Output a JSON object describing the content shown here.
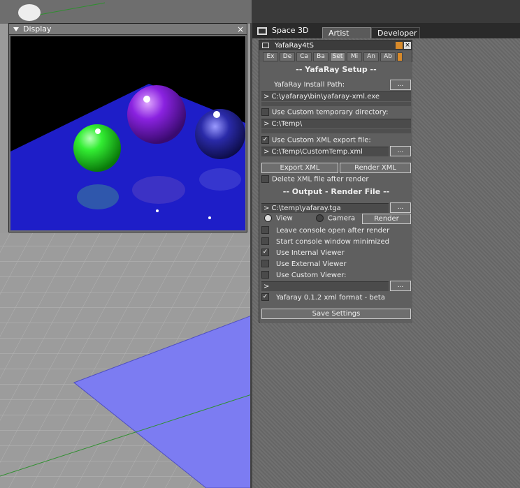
{
  "display": {
    "title": "Display",
    "close": "×"
  },
  "space3d": {
    "title": "Space 3D",
    "tabs": [
      "Artist",
      "Developer"
    ]
  },
  "yafaray": {
    "title": "YafaRay4tS",
    "close": "×",
    "tabs": [
      "Ex",
      "De",
      "Ca",
      "Ba",
      "Set",
      "Mi",
      "An",
      "Ab"
    ],
    "active_tab": "Set",
    "setup_heading": "-- YafaRay Setup --",
    "install_label": "YafaRay Install Path:",
    "install_path": "> C:\\yafaray\\bin\\yafaray-xml.exe",
    "browse": "...",
    "temp_dir_label": "Use Custom temporary directory:",
    "temp_dir_path": "> C:\\Temp\\",
    "xml_export_label": "Use Custom XML export file:",
    "xml_export_path": "> C:\\Temp\\CustomTemp.xml",
    "export_xml": "Export XML",
    "render_xml": "Render XML",
    "delete_xml_label": "Delete XML file after render",
    "output_heading": "-- Output - Render File --",
    "output_path": "> C:\\temp\\yafaray.tga",
    "view_label": "View",
    "camera_label": "Camera",
    "render_button": "Render",
    "leave_console": "Leave console open after render",
    "start_minimized": "Start console window minimized",
    "internal_viewer": "Use Internal Viewer",
    "external_viewer": "Use External Viewer",
    "custom_viewer": "Use Custom Viewer:",
    "custom_viewer_path": ">",
    "format_label": "Yafaray 0.1.2 xml format - beta",
    "save_settings": "Save Settings",
    "check": "✓"
  },
  "colors": {
    "accent": "#d88a2a",
    "floor": "#6f6fe6",
    "render_plane": "#1e1ec8"
  }
}
